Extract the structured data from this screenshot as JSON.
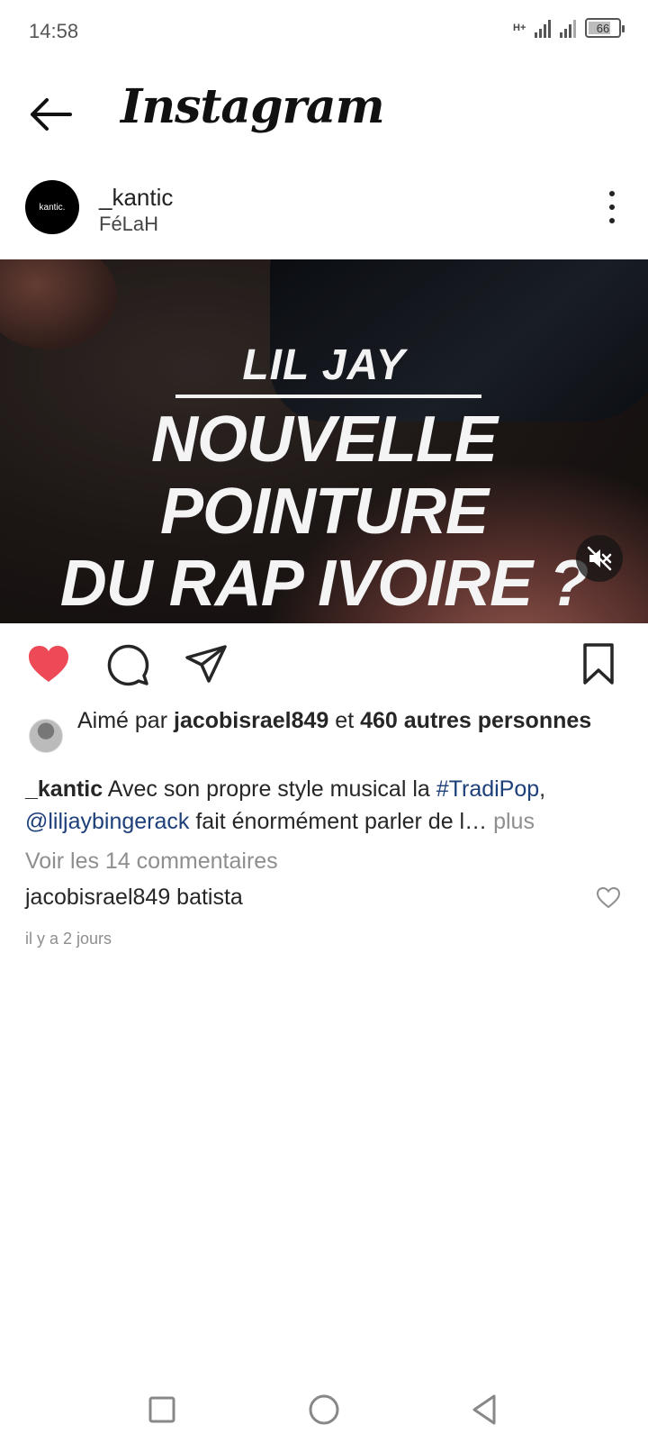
{
  "status_bar": {
    "time": "14:58",
    "network_type": "H+",
    "battery_level": "66"
  },
  "header": {
    "app_name": "Instagram"
  },
  "post": {
    "avatar_text": "kantic.",
    "username": "_kantic",
    "subtitle": "FéLaH",
    "media": {
      "line1": "LIL JAY",
      "line2": "NOUVELLE POINTURE",
      "line3": "DU RAP IVOIRE ?"
    },
    "liked": true,
    "likes": {
      "prefix": "Aimé par",
      "user": "jacobisrael849",
      "conjunction": "et",
      "others": "460 autres personnes"
    },
    "caption": {
      "author": "_kantic",
      "text1": "Avec son propre style musical la",
      "hashtag": "#TradiPop",
      "comma": ",",
      "mention": "@liljaybingerack",
      "text2": "fait énormément parler de l…",
      "more": "plus"
    },
    "view_comments": "Voir les 14 commentaires",
    "comment": {
      "user": "jacobisrael849",
      "text": "batista"
    },
    "timestamp": "il y a 2 jours"
  },
  "colors": {
    "like_red": "#ed4956",
    "link_blue": "#1d3f7a",
    "muted_gray": "#8e8e8e"
  }
}
